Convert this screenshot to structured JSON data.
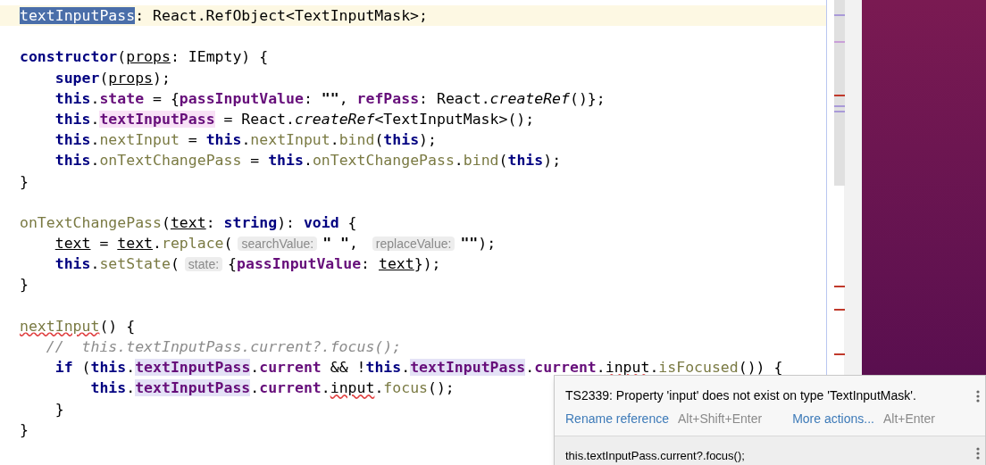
{
  "editor": {
    "lines": [
      {
        "current": true,
        "tokens": [
          {
            "kind": "selected",
            "text": "textInputPass"
          },
          {
            "kind": "plain",
            "text": ": React.RefObject<TextInputMask>;"
          }
        ]
      },
      {
        "current": false
      },
      {
        "current": false,
        "tokens": [
          {
            "kind": "kw-plain",
            "text": "constructor"
          },
          {
            "kind": "plain",
            "text": "("
          },
          {
            "kind": "param",
            "text": "props"
          },
          {
            "kind": "plain",
            "text": ": IEmpty) {"
          }
        ]
      },
      {
        "current": false,
        "tokens": [
          {
            "kind": "kw",
            "text": "    super"
          },
          {
            "kind": "plain",
            "text": "("
          },
          {
            "kind": "param",
            "text": "props"
          },
          {
            "kind": "plain",
            "text": ");"
          }
        ]
      },
      {
        "current": false,
        "tokens": [
          {
            "kind": "kw",
            "text": "    this"
          },
          {
            "kind": "plain",
            "text": "."
          },
          {
            "kind": "field",
            "text": "state"
          },
          {
            "kind": "plain",
            "text": " = {"
          },
          {
            "kind": "field",
            "text": "passInputValue"
          },
          {
            "kind": "plain",
            "text": ": "
          },
          {
            "kind": "string",
            "text": "\"\""
          },
          {
            "kind": "plain",
            "text": ", "
          },
          {
            "kind": "field",
            "text": "refPass"
          },
          {
            "kind": "plain",
            "text": ": React."
          },
          {
            "kind": "italic",
            "text": "createRef"
          },
          {
            "kind": "plain",
            "text": "()};"
          }
        ]
      },
      {
        "current": false,
        "tokens": [
          {
            "kind": "kw",
            "text": "    this"
          },
          {
            "kind": "plain",
            "text": "."
          },
          {
            "kind": "field-write",
            "text": "textInputPass"
          },
          {
            "kind": "plain",
            "text": " = React."
          },
          {
            "kind": "italic",
            "text": "createRef"
          },
          {
            "kind": "plain",
            "text": "<TextInputMask>();"
          }
        ]
      },
      {
        "current": false,
        "tokens": [
          {
            "kind": "kw",
            "text": "    this"
          },
          {
            "kind": "plain",
            "text": "."
          },
          {
            "kind": "method",
            "text": "nextInput"
          },
          {
            "kind": "plain",
            "text": " = "
          },
          {
            "kind": "kw",
            "text": "this"
          },
          {
            "kind": "plain",
            "text": "."
          },
          {
            "kind": "method",
            "text": "nextInput"
          },
          {
            "kind": "plain",
            "text": "."
          },
          {
            "kind": "method",
            "text": "bind"
          },
          {
            "kind": "plain",
            "text": "("
          },
          {
            "kind": "kw",
            "text": "this"
          },
          {
            "kind": "plain",
            "text": ");"
          }
        ]
      },
      {
        "current": false,
        "tokens": [
          {
            "kind": "kw",
            "text": "    this"
          },
          {
            "kind": "plain",
            "text": "."
          },
          {
            "kind": "method",
            "text": "onTextChangePass"
          },
          {
            "kind": "plain",
            "text": " = "
          },
          {
            "kind": "kw",
            "text": "this"
          },
          {
            "kind": "plain",
            "text": "."
          },
          {
            "kind": "method",
            "text": "onTextChangePass"
          },
          {
            "kind": "plain",
            "text": "."
          },
          {
            "kind": "method",
            "text": "bind"
          },
          {
            "kind": "plain",
            "text": "("
          },
          {
            "kind": "kw",
            "text": "this"
          },
          {
            "kind": "plain",
            "text": ");"
          }
        ]
      },
      {
        "current": false,
        "tokens": [
          {
            "kind": "plain",
            "text": "}"
          }
        ]
      },
      {
        "current": false
      },
      {
        "current": false,
        "tokens": [
          {
            "kind": "method",
            "text": "onTextChangePass"
          },
          {
            "kind": "plain",
            "text": "("
          },
          {
            "kind": "param",
            "text": "text"
          },
          {
            "kind": "plain",
            "text": ": "
          },
          {
            "kind": "kw",
            "text": "string"
          },
          {
            "kind": "plain",
            "text": "): "
          },
          {
            "kind": "kw",
            "text": "void"
          },
          {
            "kind": "plain",
            "text": " {"
          }
        ]
      },
      {
        "current": false,
        "tokens": [
          {
            "kind": "param",
            "text": "    text"
          },
          {
            "kind": "plain",
            "text": " = "
          },
          {
            "kind": "param",
            "text": "text"
          },
          {
            "kind": "plain",
            "text": "."
          },
          {
            "kind": "method",
            "text": "replace"
          },
          {
            "kind": "plain",
            "text": "("
          },
          {
            "kind": "hint",
            "text": "searchValue:"
          },
          {
            "kind": "string",
            "text": "\" \""
          },
          {
            "kind": "plain",
            "text": ", "
          },
          {
            "kind": "hint",
            "text": "replaceValue:"
          },
          {
            "kind": "string",
            "text": "\"\""
          },
          {
            "kind": "plain",
            "text": ");"
          }
        ]
      },
      {
        "current": false,
        "tokens": [
          {
            "kind": "kw",
            "text": "    this"
          },
          {
            "kind": "plain",
            "text": "."
          },
          {
            "kind": "method",
            "text": "setState"
          },
          {
            "kind": "plain",
            "text": "("
          },
          {
            "kind": "hint",
            "text": "state:"
          },
          {
            "kind": "plain",
            "text": "{"
          },
          {
            "kind": "field",
            "text": "passInputValue"
          },
          {
            "kind": "plain",
            "text": ": "
          },
          {
            "kind": "param",
            "text": "text"
          },
          {
            "kind": "plain",
            "text": "});"
          }
        ]
      },
      {
        "current": false,
        "tokens": [
          {
            "kind": "plain",
            "text": "}"
          }
        ]
      },
      {
        "current": false
      },
      {
        "current": false,
        "tokens": [
          {
            "kind": "method-error",
            "text": "nextInput"
          },
          {
            "kind": "plain",
            "text": "() {"
          }
        ]
      },
      {
        "current": false,
        "tokens": [
          {
            "kind": "comment",
            "text": "   //  this.textInputPass.current?.focus();"
          }
        ]
      },
      {
        "current": false,
        "tokens": [
          {
            "kind": "kw",
            "text": "    if"
          },
          {
            "kind": "plain",
            "text": " ("
          },
          {
            "kind": "kw",
            "text": "this"
          },
          {
            "kind": "plain",
            "text": "."
          },
          {
            "kind": "field-read",
            "text": "textInputPass"
          },
          {
            "kind": "plain",
            "text": "."
          },
          {
            "kind": "field",
            "text": "current"
          },
          {
            "kind": "plain",
            "text": " && !"
          },
          {
            "kind": "kw",
            "text": "this"
          },
          {
            "kind": "plain",
            "text": "."
          },
          {
            "kind": "field-read",
            "text": "textInputPass"
          },
          {
            "kind": "plain",
            "text": "."
          },
          {
            "kind": "field",
            "text": "current"
          },
          {
            "kind": "plain",
            "text": "."
          },
          {
            "kind": "plain-error",
            "text": "input"
          },
          {
            "kind": "plain",
            "text": "."
          },
          {
            "kind": "method",
            "text": "isFocused"
          },
          {
            "kind": "plain",
            "text": "()) {"
          }
        ]
      },
      {
        "current": false,
        "tokens": [
          {
            "kind": "kw",
            "text": "        this"
          },
          {
            "kind": "plain",
            "text": "."
          },
          {
            "kind": "field-read",
            "text": "textInputPass"
          },
          {
            "kind": "plain",
            "text": "."
          },
          {
            "kind": "field",
            "text": "current"
          },
          {
            "kind": "plain",
            "text": "."
          },
          {
            "kind": "plain-error",
            "text": "input"
          },
          {
            "kind": "plain",
            "text": "."
          },
          {
            "kind": "method",
            "text": "focus"
          },
          {
            "kind": "plain",
            "text": "();"
          }
        ]
      },
      {
        "current": false,
        "tokens": [
          {
            "kind": "plain",
            "text": "    }"
          }
        ]
      },
      {
        "current": false,
        "tokens": [
          {
            "kind": "plain",
            "text": "}"
          }
        ]
      }
    ]
  },
  "popup": {
    "message": "TS2339: Property 'input' does not exist on type 'TextInputMask'.",
    "actions": [
      {
        "label": "Rename reference",
        "shortcut": "Alt+Shift+Enter"
      },
      {
        "label": "More actions...",
        "shortcut": "Alt+Enter"
      }
    ],
    "suggestion": "this.textInputPass.current?.focus();"
  }
}
